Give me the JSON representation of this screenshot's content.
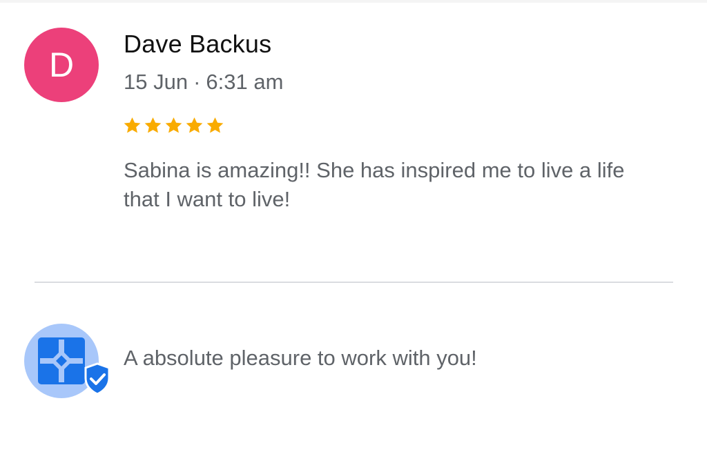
{
  "review": {
    "avatar_letter": "D",
    "author": "Dave Backus",
    "date": "15 Jun",
    "separator": "·",
    "time": "6:31 am",
    "rating": 5,
    "rating_max": 5,
    "text": "Sabina is amazing!! She has inspired me to live a life that I want to live!"
  },
  "reply": {
    "text": "A absolute pleasure to work with you!"
  },
  "colors": {
    "avatar_bg": "#ec407a",
    "star": "#f9ab00",
    "reply_avatar_bg": "#a8c7fa",
    "business_icon": "#1a73e8"
  },
  "icons": {
    "star": "star-icon",
    "business": "business-building-icon",
    "verified": "verified-shield-icon"
  }
}
